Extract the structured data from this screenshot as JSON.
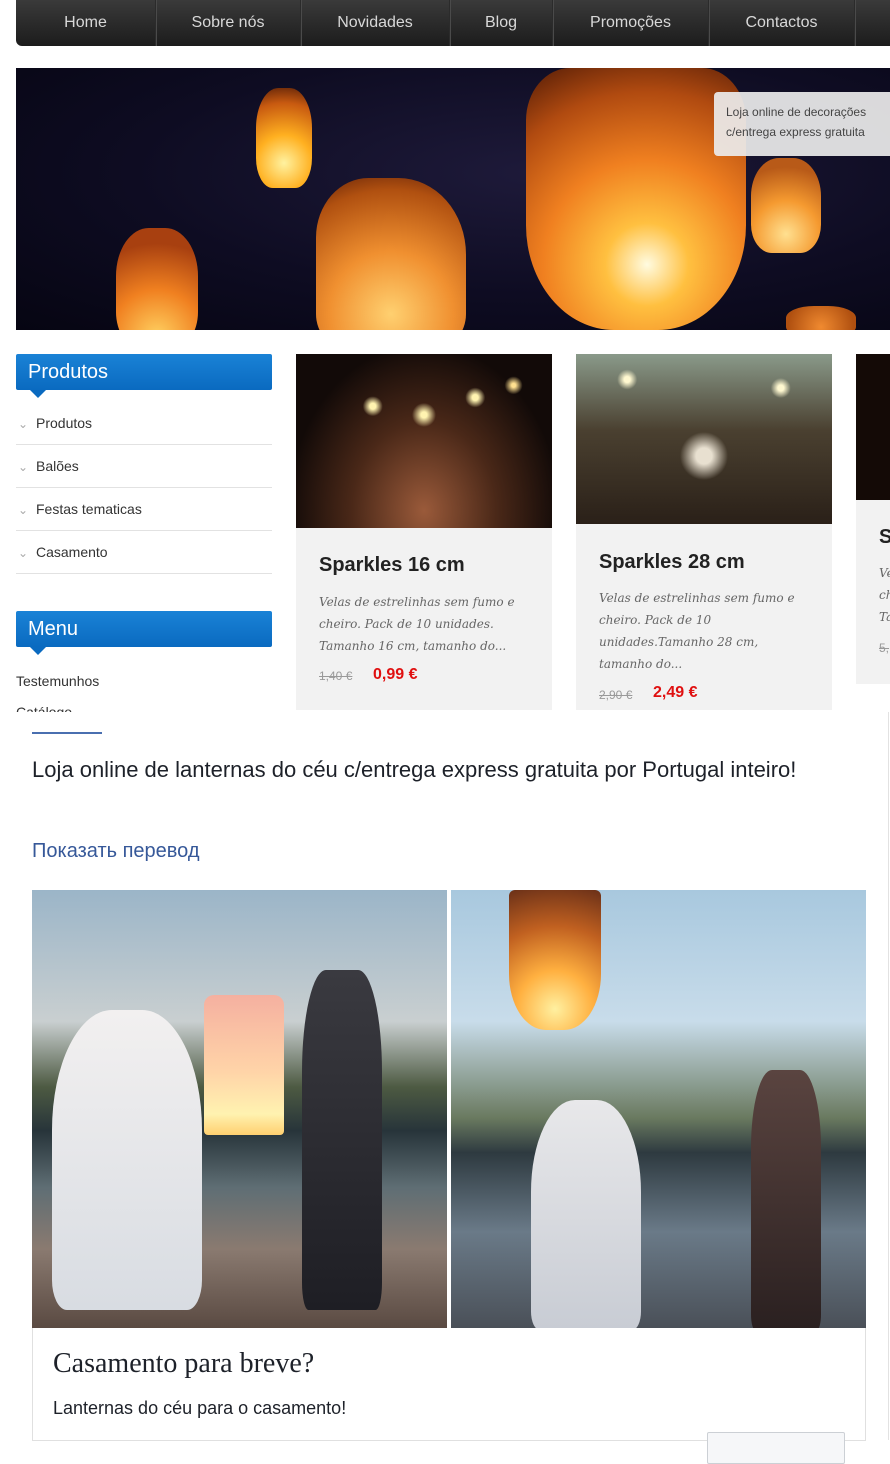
{
  "nav": {
    "items": [
      "Home",
      "Sobre nós",
      "Novidades",
      "Blog",
      "Promoções",
      "Contactos"
    ]
  },
  "hero": {
    "badge_line1": "Loja online de decorações",
    "badge_line2": "c/entrega express gratuita"
  },
  "sidebar": {
    "produtos_header": "Produtos",
    "produtos_items": [
      "Produtos",
      "Balões",
      "Festas tematicas",
      "Casamento"
    ],
    "menu_header": "Menu",
    "menu_items": [
      "Testemunhos",
      "Catálogo"
    ]
  },
  "products": [
    {
      "title": "Sparkles 16 cm",
      "desc": "Velas de estrelinhas sem fumo e cheiro. Pack de 10 unidades. Tamanho 16 cm, tamanho do...",
      "old_price": "1,40 €",
      "price": "0,99 €"
    },
    {
      "title": "Sparkles 28 cm",
      "desc": "Velas de estrelinhas sem fumo e cheiro. Pack de 10 unidades.Tamanho 28 cm, tamanho do...",
      "old_price": "2,90 €",
      "price": "2,49 €"
    },
    {
      "title": "S",
      "desc_lines": [
        "Ve",
        "ch",
        "Ta"
      ],
      "old_price": "5,"
    }
  ],
  "post": {
    "text": "Loja online de lanternas do céu c/entrega express gratuita por Portugal inteiro!",
    "translate_link": "Показать перевод",
    "card_title": "Casamento para breve?",
    "card_subtitle": "Lanternas do céu para o casamento!"
  },
  "colors": {
    "nav_bg": "#1c1c1c",
    "sidebar_header": "#0a6ac0",
    "price_red": "#e01010",
    "link_blue": "#365899"
  }
}
